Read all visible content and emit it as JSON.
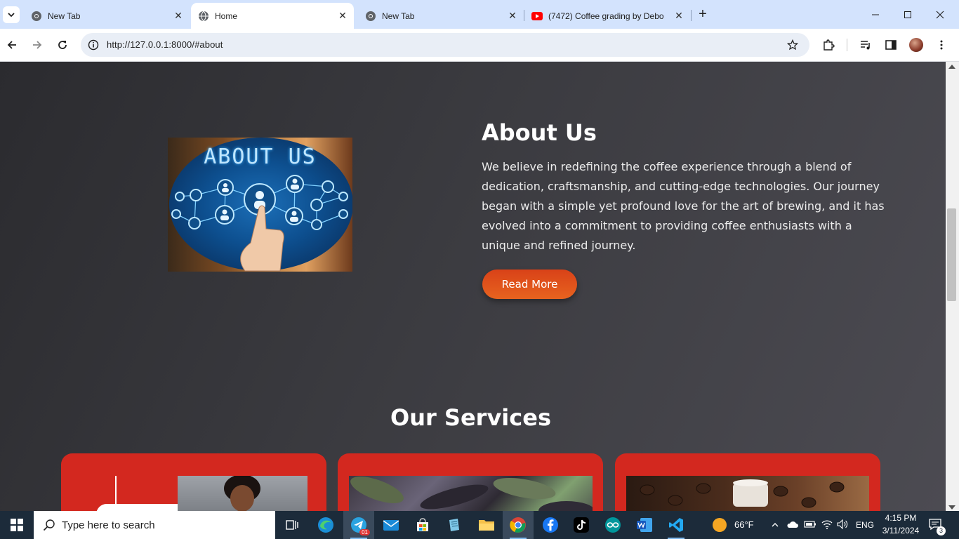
{
  "browser": {
    "tabs": [
      {
        "title": "New Tab",
        "icon": "chrome-icon",
        "active": false
      },
      {
        "title": "Home",
        "icon": "globe-icon",
        "active": true
      },
      {
        "title": "New Tab",
        "icon": "chrome-icon",
        "active": false
      },
      {
        "title": "(7472) Coffee grading by Debo",
        "icon": "youtube-icon",
        "active": false
      }
    ],
    "new_tab_label": "+",
    "url": "http://127.0.0.1:8000/#about"
  },
  "about": {
    "image_caption": "ABOUT US",
    "heading": "About Us",
    "paragraph": "We believe in redefining the coffee experience through a blend of dedication, craftsmanship, and cutting-edge technologies. Our journey began with a simple yet profound love for the art of brewing, and it has evolved into a commitment to providing coffee enthusiasts with a unique and refined journey.",
    "button_label": "Read More"
  },
  "services": {
    "heading": "Our Services",
    "cards": [
      {
        "name": "service-card-1"
      },
      {
        "name": "service-card-2"
      },
      {
        "name": "service-card-3"
      }
    ]
  },
  "taskbar": {
    "search_placeholder": "Type here to search",
    "telegram_badge": "01",
    "weather_temp": "66°F",
    "language": "ENG",
    "time": "4:15 PM",
    "date": "3/11/2024",
    "notification_count": "3"
  },
  "colors": {
    "accent_red": "#d3281f",
    "button_orange": "#e0561c",
    "tab_strip": "#d3e3fd"
  }
}
